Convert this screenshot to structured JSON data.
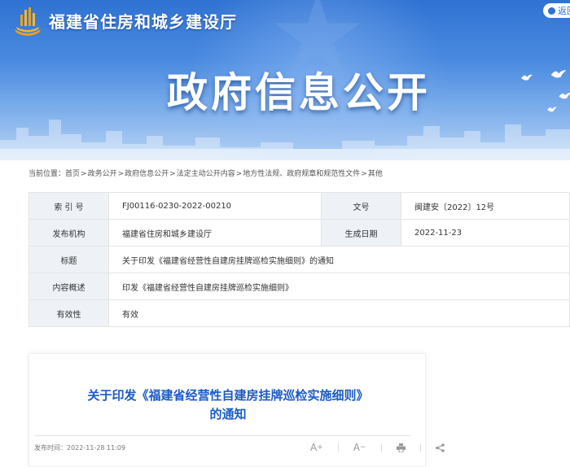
{
  "header": {
    "site_name": "福建省住房和城乡建设厅",
    "banner_title": "政府信息公开",
    "back_label": "返回"
  },
  "breadcrumb": {
    "prefix": "当前位置：",
    "items": [
      "首页",
      "政务公开",
      "政府信息公开",
      "法定主动公开内容",
      "地方性法规、政府规章和规范性文件",
      "其他"
    ]
  },
  "info": {
    "index_label": "索 引 号",
    "index_value": "FJ00116-0230-2022-00210",
    "docno_label": "文号",
    "docno_value": "闽建安〔2022〕12号",
    "publisher_label": "发布机构",
    "publisher_value": "福建省住房和城乡建设厅",
    "date_label": "生成日期",
    "date_value": "2022-11-23",
    "title_label": "标题",
    "title_value": "关于印发《福建省经营性自建房挂牌巡检实施细则》的通知",
    "summary_label": "内容概述",
    "summary_value": "印发《福建省经营性自建房挂牌巡检实施细则》",
    "validity_label": "有效性",
    "validity_value": "有效"
  },
  "article": {
    "title": "关于印发《福建省经营性自建房挂牌巡检实施细则》的通知",
    "pubtime_label": "发布时间：",
    "pubtime_value": "2022-11-28 11:09",
    "font_increase_label": "A",
    "font_decrease_label": "A",
    "font_increase_sign": "+",
    "font_decrease_sign": "−"
  },
  "colors": {
    "banner_top": "#2f72d2",
    "title_blue": "#1a5bc4",
    "table_label_bg": "#eef2f7"
  },
  "icons": [
    "logo-emblem-icon",
    "back-arrow-icon",
    "dove-icon",
    "print-icon",
    "share-icon"
  ]
}
